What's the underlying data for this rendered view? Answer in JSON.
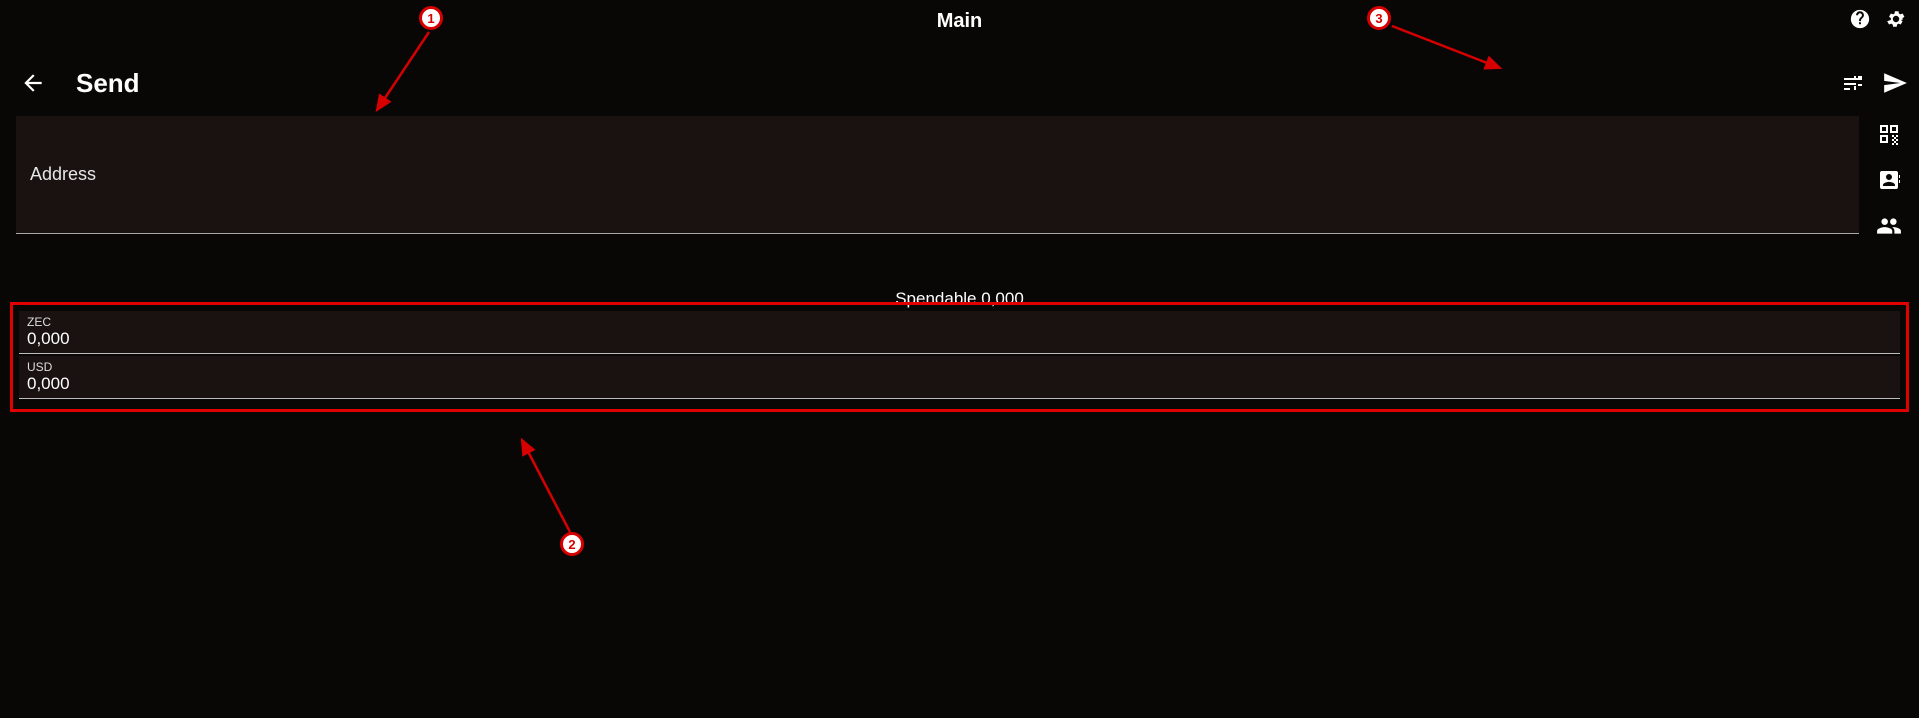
{
  "header": {
    "title": "Main"
  },
  "page": {
    "title": "Send"
  },
  "address": {
    "placeholder": "Address"
  },
  "spendable": {
    "label": "Spendable  0,000"
  },
  "amounts": {
    "zec": {
      "label": "ZEC",
      "value": "0,000"
    },
    "usd": {
      "label": "USD",
      "value": "0,000"
    }
  },
  "annotations": {
    "a1": "1",
    "a2": "2",
    "a3": "3"
  }
}
